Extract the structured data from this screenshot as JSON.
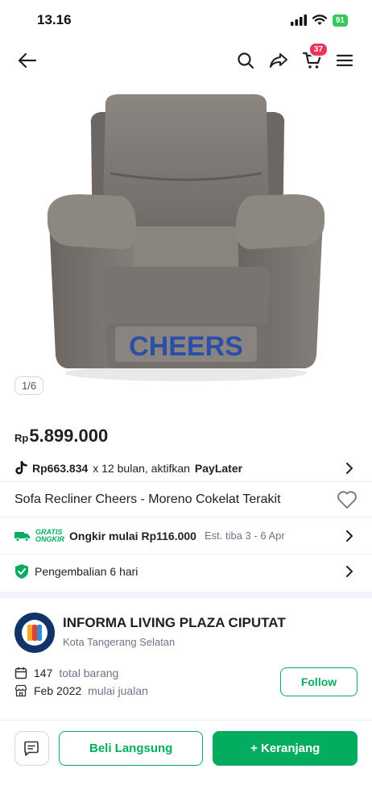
{
  "status": {
    "time": "13.16",
    "battery": "91"
  },
  "header": {
    "cart_count": "37"
  },
  "gallery": {
    "counter": "1/6",
    "brand_text": "CHEERS"
  },
  "price": {
    "currency": "Rp",
    "value": "5.899.000"
  },
  "paylater": {
    "amount": "Rp663.834",
    "tenor": "x 12 bulan, aktifkan",
    "brand": "PayLater"
  },
  "product": {
    "title": "Sofa Recliner Cheers - Moreno Cokelat Terakit"
  },
  "shipping": {
    "badge_line1": "GRATIS",
    "badge_line2": "ONGKIR",
    "main": "Ongkir mulai Rp116.000",
    "estimate": "Est. tiba 3 - 6 Apr"
  },
  "returns": {
    "label": "Pengembalian 6 hari"
  },
  "shop": {
    "name": "INFORMA LIVING PLAZA CIPUTAT",
    "location": "Kota Tangerang Selatan",
    "total_items": "147",
    "total_items_label": "total barang",
    "since": "Feb 2022",
    "since_label": "mulai jualan",
    "follow_label": "Follow"
  },
  "actions": {
    "buy_now": "Beli Langsung",
    "add_cart": "+ Keranjang"
  },
  "colors": {
    "accent": "#03ac5f",
    "badge": "#e9365b"
  }
}
